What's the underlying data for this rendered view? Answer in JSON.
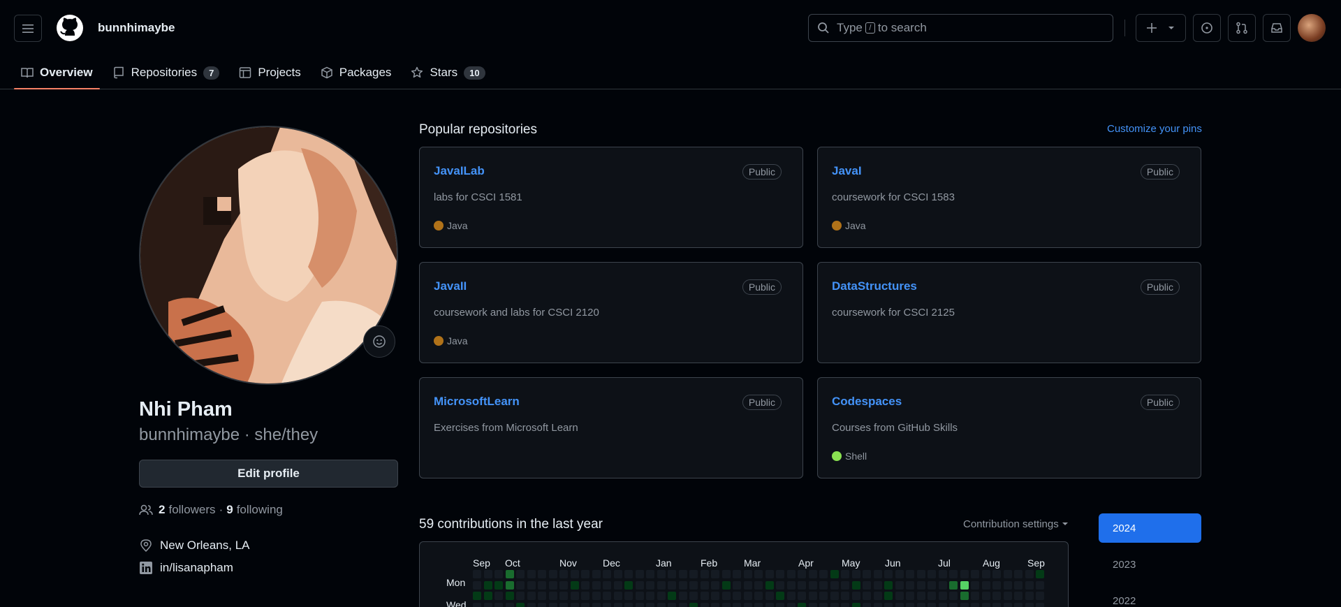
{
  "header": {
    "username": "bunnhimaybe",
    "search_prefix": "Type",
    "search_key": "/",
    "search_suffix": "to search"
  },
  "tabs": [
    {
      "label": "Overview",
      "icon": "book-icon"
    },
    {
      "label": "Repositories",
      "icon": "repo-icon",
      "count": "7"
    },
    {
      "label": "Projects",
      "icon": "table-icon"
    },
    {
      "label": "Packages",
      "icon": "package-icon"
    },
    {
      "label": "Stars",
      "icon": "star-icon",
      "count": "10"
    }
  ],
  "profile": {
    "full_name": "Nhi Pham",
    "login_line": "bunnhimaybe · she/they",
    "edit_label": "Edit profile",
    "followers_count": "2",
    "followers_label": "followers",
    "sep": "·",
    "following_count": "9",
    "following_label": "following",
    "location": "New Orleans, LA",
    "linkedin": "in/lisanapham"
  },
  "popular": {
    "title": "Popular repositories",
    "customize": "Customize your pins",
    "repos": [
      {
        "name": "JavaILab",
        "badge": "Public",
        "desc": "labs for CSCI 1581",
        "lang": "Java",
        "lang_color": "#b07219"
      },
      {
        "name": "JavaI",
        "badge": "Public",
        "desc": "coursework for CSCI 1583",
        "lang": "Java",
        "lang_color": "#b07219"
      },
      {
        "name": "JavaII",
        "badge": "Public",
        "desc": "coursework and labs for CSCI 2120",
        "lang": "Java",
        "lang_color": "#b07219"
      },
      {
        "name": "DataStructures",
        "badge": "Public",
        "desc": "coursework for CSCI 2125",
        "lang": "",
        "lang_color": ""
      },
      {
        "name": "MicrosoftLearn",
        "badge": "Public",
        "desc": "Exercises from Microsoft Learn",
        "lang": "",
        "lang_color": ""
      },
      {
        "name": "Codespaces",
        "badge": "Public",
        "desc": "Courses from GitHub Skills",
        "lang": "Shell",
        "lang_color": "#89e051"
      }
    ]
  },
  "contributions": {
    "title": "59 contributions in the last year",
    "settings": "Contribution settings",
    "months": [
      "Sep",
      "Oct",
      "Nov",
      "Dec",
      "Jan",
      "Feb",
      "Mar",
      "Apr",
      "May",
      "Jun",
      "Jul",
      "Aug",
      "Sep"
    ],
    "days": [
      "Mon",
      "Wed"
    ],
    "years": [
      "2024",
      "2023",
      "2022"
    ]
  },
  "colors": {
    "accent": "#4493f8",
    "tab_underline": "#f78166",
    "year_active": "#1f6feb",
    "contrib_levels": [
      "#151b23",
      "#033a16",
      "#196c2e",
      "#2ea043",
      "#56d364"
    ]
  }
}
